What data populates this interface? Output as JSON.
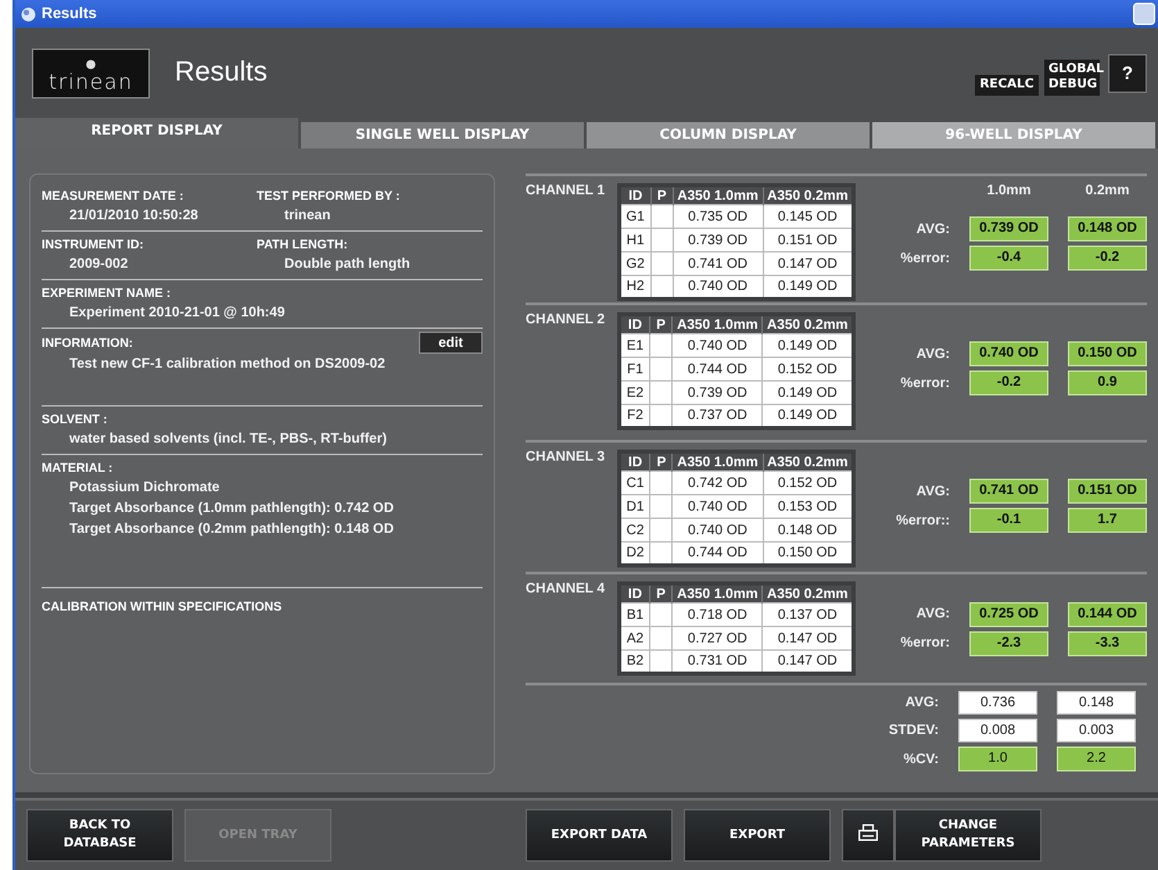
{
  "window": {
    "title": "Results"
  },
  "header": {
    "logo": "trinean",
    "title": "Results",
    "buttons": [
      {
        "label": "RECALC",
        "kind": "text"
      },
      {
        "label": "GLOBAL DEBUG",
        "kind": "text"
      },
      {
        "label": "?",
        "kind": "help"
      }
    ]
  },
  "tabs": [
    {
      "label": "REPORT DISPLAY",
      "selected": true
    },
    {
      "label": "SINGLE WELL DISPLAY",
      "selected": false
    },
    {
      "label": "COLUMN DISPLAY",
      "selected": false
    },
    {
      "label": "96-WELL DISPLAY",
      "selected": false
    }
  ],
  "report": {
    "sections": [
      {
        "kind": "pair",
        "fields": [
          {
            "label": "MEASUREMENT DATE :",
            "value": "21/01/2010 10:50:28"
          },
          {
            "label": "TEST PERFORMED BY :",
            "value": "trinean"
          }
        ]
      },
      {
        "kind": "pair",
        "fields": [
          {
            "label": "INSTRUMENT ID:",
            "value": "2009-002"
          },
          {
            "label": "PATH LENGTH:",
            "value": "Double path length"
          }
        ]
      },
      {
        "kind": "single",
        "label": "EXPERIMENT NAME :",
        "lines": [
          "Experiment 2010-21-01 @ 10h:49"
        ]
      },
      {
        "kind": "single",
        "label": "INFORMATION:",
        "action": "edit",
        "lines": [
          "Test new CF-1 calibration method on DS2009-02"
        ]
      },
      {
        "kind": "single",
        "label": "SOLVENT :",
        "lines": [
          "water based solvents (incl. TE-, PBS-, RT-buffer)"
        ]
      },
      {
        "kind": "single",
        "label": "MATERIAL :",
        "lines": [
          "Potassium Dichromate",
          "Target Absorbance (1.0mm pathlength): 0.742 OD",
          "Target Absorbance (0.2mm pathlength): 0.148 OD"
        ]
      },
      {
        "kind": "status",
        "label": "CALIBRATION WITHIN SPECIFICATIONS"
      }
    ]
  },
  "summary_headers": [
    "1.0mm",
    "0.2mm"
  ],
  "channels": [
    {
      "name": "CHANNEL 1",
      "columns": [
        "ID",
        "P",
        "A350 1.0mm",
        "A350 0.2mm"
      ],
      "rows": [
        {
          "id": "G1",
          "a10": "0.735 OD",
          "a02": "0.145 OD"
        },
        {
          "id": "H1",
          "a10": "0.739 OD",
          "a02": "0.151 OD"
        },
        {
          "id": "G2",
          "a10": "0.741 OD",
          "a02": "0.147 OD"
        },
        {
          "id": "H2",
          "a10": "0.740 OD",
          "a02": "0.149 OD"
        }
      ],
      "avg_label": "AVG:",
      "avg": [
        "0.739 OD",
        "0.148 OD"
      ],
      "error_label": "%error:",
      "error": [
        "-0.4",
        "-0.2"
      ]
    },
    {
      "name": "CHANNEL 2",
      "columns": [
        "ID",
        "P",
        "A350 1.0mm",
        "A350 0.2mm"
      ],
      "rows": [
        {
          "id": "E1",
          "a10": "0.740 OD",
          "a02": "0.149 OD"
        },
        {
          "id": "F1",
          "a10": "0.744 OD",
          "a02": "0.152 OD"
        },
        {
          "id": "E2",
          "a10": "0.739 OD",
          "a02": "0.149 OD"
        },
        {
          "id": "F2",
          "a10": "0.737 OD",
          "a02": "0.149 OD"
        }
      ],
      "avg_label": "AVG:",
      "avg": [
        "0.740 OD",
        "0.150 OD"
      ],
      "error_label": "%error:",
      "error": [
        "-0.2",
        "0.9"
      ]
    },
    {
      "name": "CHANNEL 3",
      "columns": [
        "ID",
        "P",
        "A350 1.0mm",
        "A350 0.2mm"
      ],
      "rows": [
        {
          "id": "C1",
          "a10": "0.742 OD",
          "a02": "0.152 OD"
        },
        {
          "id": "D1",
          "a10": "0.740 OD",
          "a02": "0.153 OD"
        },
        {
          "id": "C2",
          "a10": "0.740 OD",
          "a02": "0.148 OD"
        },
        {
          "id": "D2",
          "a10": "0.744 OD",
          "a02": "0.150 OD"
        }
      ],
      "avg_label": "AVG:",
      "avg": [
        "0.741 OD",
        "0.151 OD"
      ],
      "error_label": "%error::",
      "error": [
        "-0.1",
        "1.7"
      ]
    },
    {
      "name": "CHANNEL 4",
      "columns": [
        "ID",
        "P",
        "A350 1.0mm",
        "A350 0.2mm"
      ],
      "rows": [
        {
          "id": "B1",
          "a10": "0.718 OD",
          "a02": "0.137 OD"
        },
        {
          "id": "A2",
          "a10": "0.727 OD",
          "a02": "0.147 OD"
        },
        {
          "id": "B2",
          "a10": "0.731 OD",
          "a02": "0.147 OD"
        }
      ],
      "avg_label": "AVG:",
      "avg": [
        "0.725 OD",
        "0.144 OD"
      ],
      "error_label": "%error:",
      "error": [
        "-2.3",
        "-3.3"
      ]
    }
  ],
  "totals": [
    {
      "label": "AVG:",
      "values": [
        "0.736",
        "0.148"
      ],
      "highlight": false
    },
    {
      "label": "STDEV:",
      "values": [
        "0.008",
        "0.003"
      ],
      "highlight": false
    },
    {
      "label": "%CV:",
      "values": [
        "1.0",
        "2.2"
      ],
      "highlight": true
    }
  ],
  "footer": {
    "left": [
      {
        "label": "BACK TO\nDATABASE",
        "kind": "text",
        "disabled": false
      },
      {
        "label": "OPEN TRAY",
        "kind": "text",
        "disabled": true
      }
    ],
    "center": [
      {
        "label": "EXPORT DATA",
        "kind": "text",
        "disabled": false
      },
      {
        "label": "EXPORT",
        "kind": "text",
        "disabled": false
      },
      {
        "kind": "print",
        "disabled": false
      }
    ],
    "right": [
      {
        "label": "CHANGE\nPARAMETERS",
        "kind": "text",
        "disabled": false
      }
    ]
  }
}
